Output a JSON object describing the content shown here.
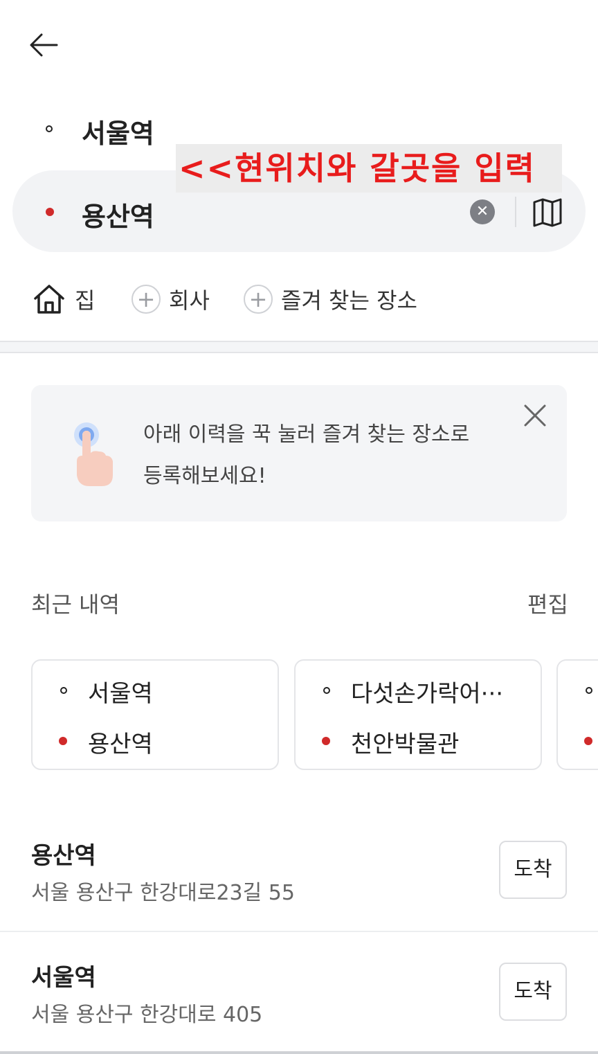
{
  "header": {
    "back_icon": "arrow-left-icon"
  },
  "route": {
    "origin": "서울역",
    "destination": "용산역",
    "clear_icon": "clear-icon",
    "map_icon": "map-icon"
  },
  "annotation": {
    "text": "<<현위치와 갈곳을 입력"
  },
  "shortcuts": [
    {
      "label": "집",
      "icon": "home-icon"
    },
    {
      "label": "회사",
      "icon": "plus-circle-icon"
    },
    {
      "label": "즐겨 찾는 장소",
      "icon": "plus-circle-icon"
    }
  ],
  "tip": {
    "line1": "아래 이력을 꾹 눌러 즐겨 찾는 장소로",
    "line2": "등록해보세요!",
    "icon": "tap-hand-icon",
    "close_icon": "close-icon"
  },
  "recent": {
    "title": "최근 내역",
    "edit_label": "편집",
    "cards": [
      {
        "origin": "서울역",
        "destination": "용산역"
      },
      {
        "origin": "다섯손가락어···",
        "destination": "천안박물관"
      },
      {
        "origin": "",
        "destination": ""
      }
    ]
  },
  "results": [
    {
      "name": "용산역",
      "address": "서울 용산구 한강대로23길 55",
      "action": "도착"
    },
    {
      "name": "서울역",
      "address": "서울 용산구 한강대로 405",
      "action": "도착"
    }
  ],
  "colors": {
    "accent_red": "#d02a2a",
    "annotation_red": "#e81c1c",
    "surface": "#f2f3f5"
  }
}
